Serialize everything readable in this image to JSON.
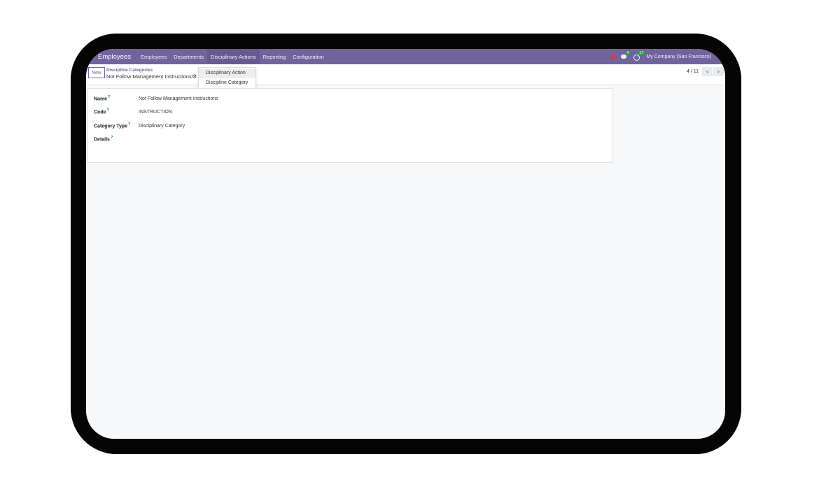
{
  "navbar": {
    "app_name": "Employees",
    "menu": [
      "Employees",
      "Departments",
      "Disciplinary Actions",
      "Reporting",
      "Configuration"
    ],
    "chat_badge": "4",
    "activity_badge": "17",
    "company": "My Company (San Francisco)"
  },
  "control_panel": {
    "new_label": "New",
    "breadcrumb_parent": "Discipline Categories",
    "breadcrumb_current": "Not Follow Management Instructions",
    "pager": "4 / 11"
  },
  "dropdown": {
    "items": [
      "Disciplinary Action",
      "Discipline Category"
    ]
  },
  "form": {
    "name_label": "Name",
    "name_value": "Not Follow Management Instructions",
    "code_label": "Code",
    "code_value": "INSTRUCTION",
    "category_type_label": "Category Type",
    "category_type_value": "Disciplinary Category",
    "details_label": "Details",
    "help_mark": "?"
  },
  "colors": {
    "brand": "#71639e",
    "background": "#f7f8fa"
  },
  "icons": [
    "bug-icon",
    "chat-icon",
    "clock-icon",
    "gear-icon",
    "chevron-left-icon",
    "chevron-right-icon"
  ]
}
